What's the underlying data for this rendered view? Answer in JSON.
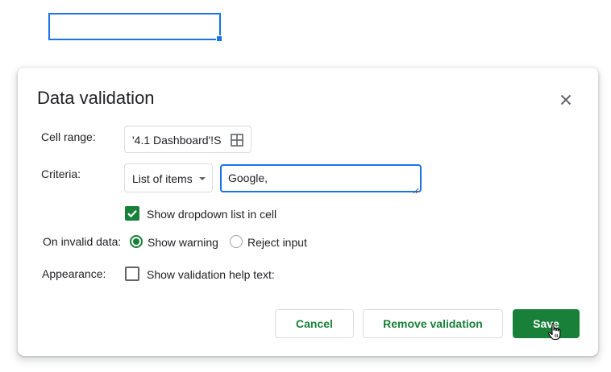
{
  "dialog": {
    "title": "Data validation",
    "close_icon": "close-icon"
  },
  "cell_range": {
    "label": "Cell range:",
    "value": "'4.1 Dashboard'!S",
    "icon": "grid-select-icon"
  },
  "criteria": {
    "label": "Criteria:",
    "selected": "List of items",
    "items_value": "Google,"
  },
  "dropdown_option": {
    "label": "Show dropdown list in cell",
    "checked": true
  },
  "invalid_data": {
    "label": "On invalid data:",
    "options": [
      {
        "label": "Show warning",
        "selected": true
      },
      {
        "label": "Reject input",
        "selected": false
      }
    ]
  },
  "appearance": {
    "label": "Appearance:",
    "help_text_label": "Show validation help text:",
    "checked": false
  },
  "buttons": {
    "cancel": "Cancel",
    "remove": "Remove validation",
    "save": "Save"
  },
  "colors": {
    "accent_green": "#188038",
    "focus_blue": "#1a73e8"
  }
}
